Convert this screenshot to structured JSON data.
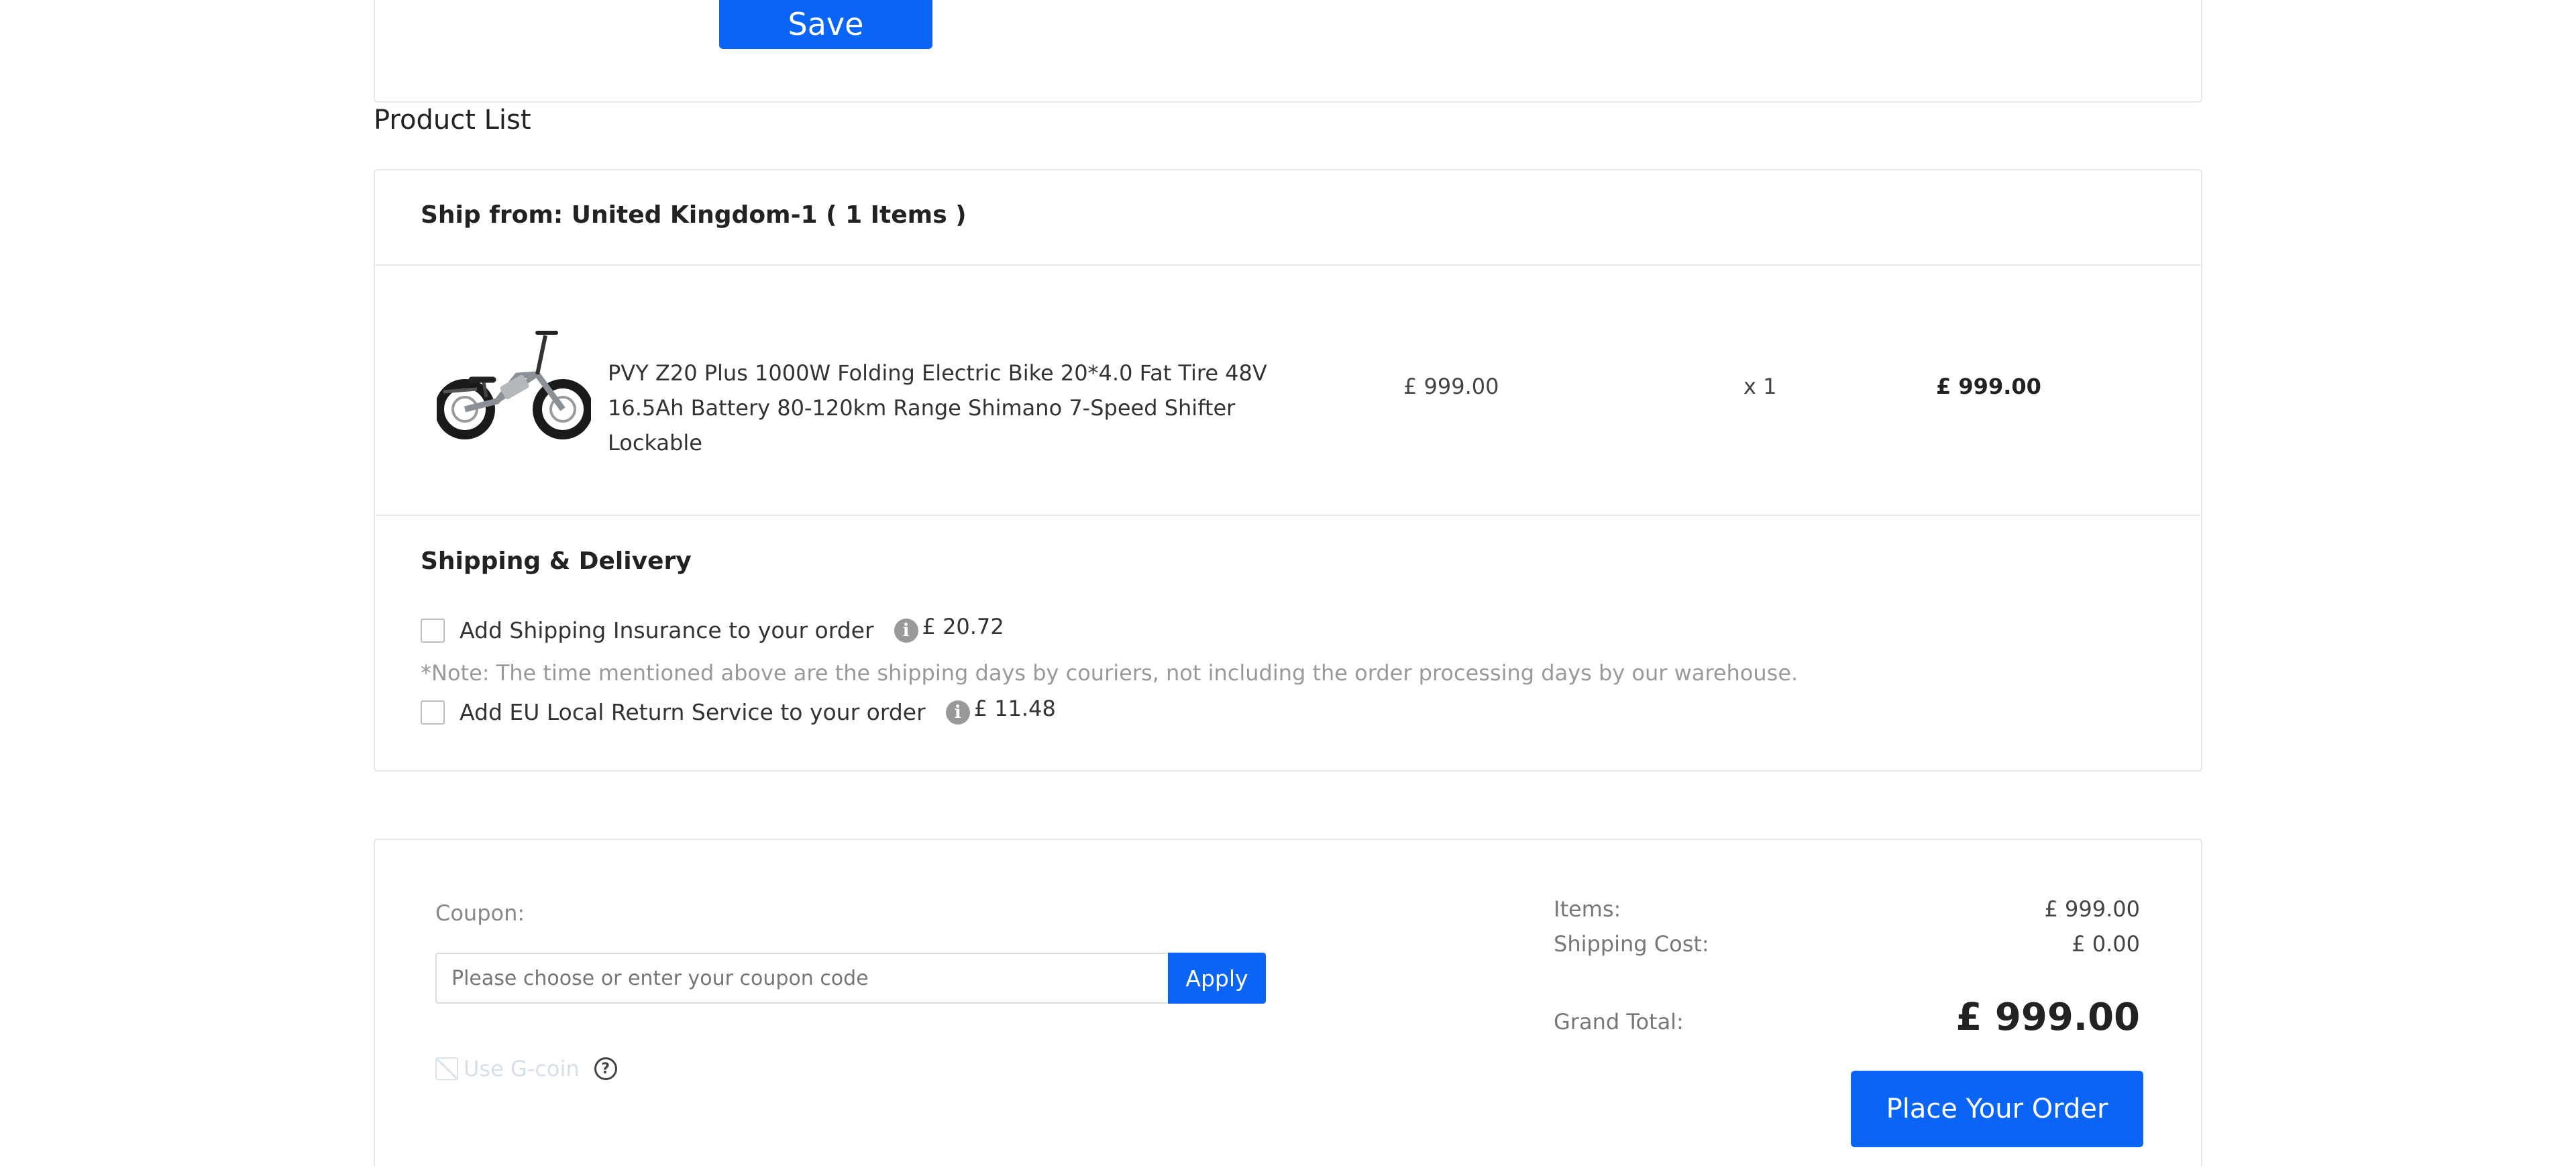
{
  "address_form": {
    "save_label": "Save"
  },
  "product_list": {
    "title": "Product List",
    "ship_from": "Ship from: United Kingdom-1 ( 1 Items )",
    "items": [
      {
        "image_icon": "folding-electric-bike-photo",
        "name": "PVY Z20 Plus 1000W Folding Electric Bike 20*4.0 Fat Tire 48V 16.5Ah Battery 80-120km Range Shimano 7-Speed Shifter Lockable",
        "unit_price": "£ 999.00",
        "quantity": "x 1",
        "line_total": "£ 999.00"
      }
    ]
  },
  "shipping": {
    "title": "Shipping & Delivery",
    "insurance": {
      "label": "Add Shipping Insurance to your order",
      "info_icon": "info-icon",
      "price": "£ 20.72",
      "checked": false
    },
    "note": "*Note: The time mentioned above are the shipping days by couriers, not including the order processing days by our warehouse.",
    "return_service": {
      "label": "Add EU Local Return Service to your order",
      "info_icon": "info-icon",
      "price": "£ 11.48",
      "checked": false
    }
  },
  "coupon": {
    "label": "Coupon:",
    "placeholder": "Please choose or enter your coupon code",
    "apply_label": "Apply",
    "gcoin_label": "Use G-coin",
    "gcoin_enabled": false,
    "help_icon": "question-circle-icon"
  },
  "summary": {
    "items_label": "Items:",
    "items_value": "£ 999.00",
    "shipping_label": "Shipping Cost:",
    "shipping_value": "£ 0.00",
    "grand_total_label": "Grand Total:",
    "grand_total_value": "£ 999.00",
    "place_order_label": "Place Your Order"
  },
  "colors": {
    "accent": "#0a64f5",
    "border": "#e8e8e8",
    "muted_text": "#999999"
  }
}
